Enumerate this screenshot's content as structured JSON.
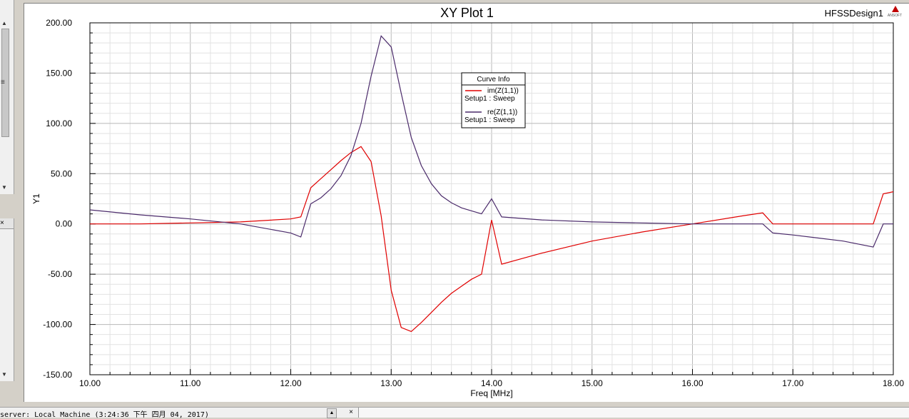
{
  "window": {
    "plot_title": "XY Plot 1",
    "design_name": "HFSSDesign1",
    "logo_text": "ANSOFT",
    "status_text": "server: Local Machine  (3:24:36 下午  四月 04, 2017)",
    "side_panel_close": "×",
    "status_close": "×",
    "status_scroll_arrow": "▲"
  },
  "chart_data": {
    "type": "line",
    "xlabel": "Freq [MHz]",
    "ylabel": "Y1",
    "xlim": [
      10,
      18
    ],
    "ylim": [
      -150,
      200
    ],
    "grid": true,
    "x_ticks": [
      10,
      11,
      12,
      13,
      14,
      15,
      16,
      17,
      18
    ],
    "x_tick_labels": [
      "10.00",
      "11.00",
      "12.00",
      "13.00",
      "14.00",
      "15.00",
      "16.00",
      "17.00",
      "18.00"
    ],
    "y_ticks": [
      -150,
      -100,
      -50,
      0,
      50,
      100,
      150,
      200
    ],
    "y_tick_labels": [
      "-150.00",
      "-100.00",
      "-50.00",
      "0.00",
      "50.00",
      "100.00",
      "150.00",
      "200.00"
    ],
    "legend": {
      "title": "Curve Info",
      "placement": "top-center"
    },
    "series": [
      {
        "name": "im(Z(1,1))",
        "setup": "Setup1 : Sweep",
        "color": "#e00000",
        "x": [
          10.0,
          10.5,
          11.0,
          11.5,
          12.0,
          12.1,
          12.2,
          12.3,
          12.4,
          12.5,
          12.6,
          12.7,
          12.8,
          12.9,
          13.0,
          13.1,
          13.2,
          13.3,
          13.4,
          13.5,
          13.6,
          13.7,
          13.8,
          13.9,
          14.0,
          14.1,
          14.5,
          15.0,
          15.5,
          16.0,
          16.5,
          16.7,
          16.8,
          17.0,
          17.5,
          17.8,
          17.9,
          18.0
        ],
        "y": [
          0,
          0,
          1,
          2,
          5,
          7,
          36,
          45,
          54,
          63,
          71,
          77,
          62,
          8,
          -66,
          -103,
          -107,
          -98,
          -88,
          -78,
          -69,
          -62,
          -55,
          -50,
          4,
          -40,
          -29,
          -17,
          -8,
          0,
          8,
          11,
          0,
          0,
          0,
          0,
          30,
          32
        ]
      },
      {
        "name": "re(Z(1,1))",
        "setup": "Setup1 : Sweep",
        "color": "#4a2a6a",
        "x": [
          10.0,
          10.5,
          11.0,
          11.5,
          12.0,
          12.1,
          12.2,
          12.3,
          12.4,
          12.5,
          12.6,
          12.7,
          12.8,
          12.9,
          13.0,
          13.1,
          13.2,
          13.3,
          13.4,
          13.5,
          13.6,
          13.7,
          13.8,
          13.9,
          14.0,
          14.1,
          14.5,
          15.0,
          15.5,
          16.0,
          16.5,
          16.7,
          16.8,
          17.0,
          17.5,
          17.8,
          17.9,
          18.0
        ],
        "y": [
          14,
          9,
          5,
          0,
          -9,
          -13,
          20,
          26,
          35,
          48,
          68,
          100,
          147,
          187,
          176,
          130,
          86,
          58,
          40,
          28,
          21,
          16,
          13,
          10,
          25,
          7,
          4,
          2,
          1,
          0,
          0,
          0,
          -9,
          -11,
          -17,
          -23,
          0,
          0
        ]
      }
    ]
  }
}
